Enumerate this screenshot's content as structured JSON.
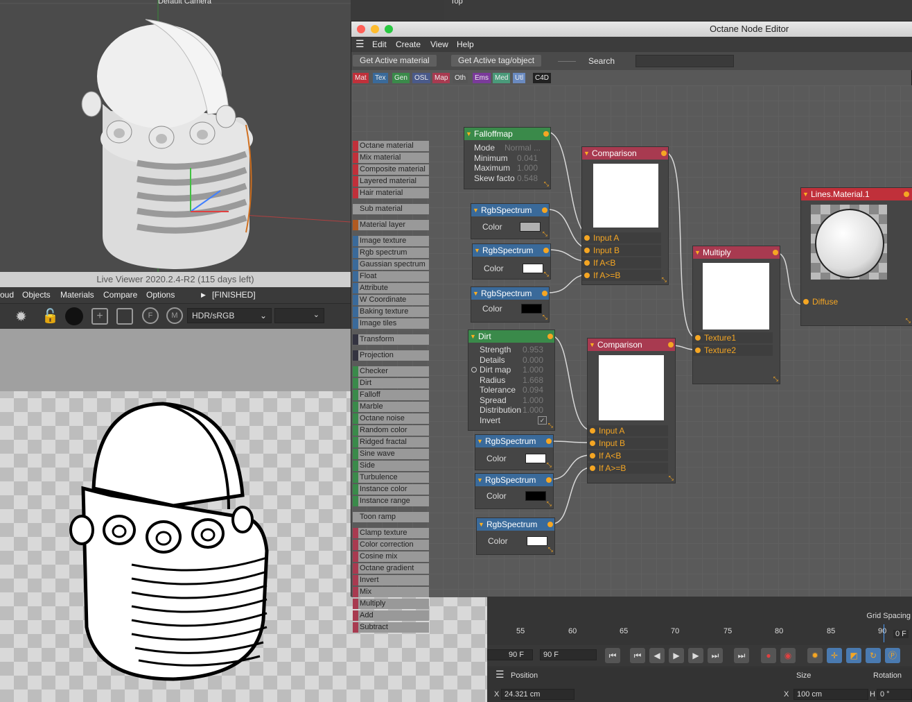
{
  "viewport": {
    "camera_label": "Default Camera",
    "top_label": "Top"
  },
  "live_viewer": {
    "title": "Live Viewer 2020.2.4-R2 (115 days left)",
    "menu": [
      "oud",
      "Objects",
      "Materials",
      "Compare",
      "Options"
    ],
    "status": "[FINISHED]",
    "color_mode": "HDR/sRGB"
  },
  "node_editor": {
    "title": "Octane Node Editor",
    "menu": [
      "Edit",
      "Create",
      "View",
      "Help"
    ],
    "buttons": {
      "get_material": "Get Active material",
      "get_tag": "Get Active tag/object",
      "search_label": "Search"
    },
    "categories": [
      {
        "label": "Mat",
        "color": "#c0303a"
      },
      {
        "label": "Tex",
        "color": "#3a6a9a"
      },
      {
        "label": "Gen",
        "color": "#3a8a4a"
      },
      {
        "label": "OSL",
        "color": "#4a5a8a"
      },
      {
        "label": "Map",
        "color": "#a83a50"
      },
      {
        "label": "Oth",
        "color": "#555555"
      },
      {
        "label": "Ems",
        "color": "#7a3a9a"
      },
      {
        "label": "Med",
        "color": "#4a9a7a"
      },
      {
        "label": "Utl",
        "color": "#6a8ac0"
      },
      {
        "label": "C4D",
        "color": "#222222"
      }
    ],
    "node_list": [
      {
        "label": "Octane material",
        "color": "#c0303a"
      },
      {
        "label": "Mix material",
        "color": "#c0303a"
      },
      {
        "label": "Composite material",
        "color": "#c0303a"
      },
      {
        "label": "Layered material",
        "color": "#c0303a"
      },
      {
        "label": "Hair material",
        "color": "#c0303a"
      },
      {
        "label": "Sub material",
        "color": "#999999"
      },
      {
        "label": "Material layer",
        "color": "#b05a20"
      },
      {
        "label": "Image texture",
        "color": "#3a6a9a"
      },
      {
        "label": "Rgb spectrum",
        "color": "#3a6a9a"
      },
      {
        "label": "Gaussian spectrum",
        "color": "#3a6a9a"
      },
      {
        "label": "Float",
        "color": "#3a6a9a"
      },
      {
        "label": "Attribute",
        "color": "#3a6a9a"
      },
      {
        "label": "W Coordinate",
        "color": "#3a6a9a"
      },
      {
        "label": "Baking texture",
        "color": "#3a6a9a"
      },
      {
        "label": "Image tiles",
        "color": "#3a6a9a"
      },
      {
        "label": "Transform",
        "color": "#333340"
      },
      {
        "label": "Projection",
        "color": "#333340"
      },
      {
        "label": "Checker",
        "color": "#3a8a4a"
      },
      {
        "label": "Dirt",
        "color": "#3a8a4a"
      },
      {
        "label": "Falloff",
        "color": "#3a8a4a"
      },
      {
        "label": "Marble",
        "color": "#3a8a4a"
      },
      {
        "label": "Octane noise",
        "color": "#3a8a4a"
      },
      {
        "label": "Random color",
        "color": "#3a8a4a"
      },
      {
        "label": "Ridged fractal",
        "color": "#3a8a4a"
      },
      {
        "label": "Sine wave",
        "color": "#3a8a4a"
      },
      {
        "label": "Side",
        "color": "#3a8a4a"
      },
      {
        "label": "Turbulence",
        "color": "#3a8a4a"
      },
      {
        "label": "Instance color",
        "color": "#3a8a4a"
      },
      {
        "label": "Instance range",
        "color": "#3a8a4a"
      },
      {
        "label": "Toon ramp",
        "color": "#999999"
      },
      {
        "label": "Clamp texture",
        "color": "#a83a50"
      },
      {
        "label": "Color correction",
        "color": "#a83a50"
      },
      {
        "label": "Cosine mix",
        "color": "#a83a50"
      },
      {
        "label": "Octane gradient",
        "color": "#a83a50"
      },
      {
        "label": "Invert",
        "color": "#a83a50"
      },
      {
        "label": "Mix",
        "color": "#a83a50"
      },
      {
        "label": "Multiply",
        "color": "#a83a50"
      },
      {
        "label": "Add",
        "color": "#a83a50"
      },
      {
        "label": "Subtract",
        "color": "#a83a50"
      }
    ],
    "falloff": {
      "title": "Falloffmap",
      "params": [
        [
          "Mode",
          "Normal ..."
        ],
        [
          "Minimum",
          "0.041"
        ],
        [
          "Maximum",
          "1.000"
        ],
        [
          "Skew facto",
          "0.548"
        ]
      ]
    },
    "dirt": {
      "title": "Dirt",
      "params": [
        [
          "Strength",
          "0.953"
        ],
        [
          "Details",
          "0.000"
        ],
        [
          "Dirt map",
          "1.000"
        ],
        [
          "Radius",
          "1.668"
        ],
        [
          "Tolerance",
          "0.094"
        ],
        [
          "Spread",
          "1.000"
        ],
        [
          "Distribution",
          "1.000"
        ],
        [
          "Invert",
          ""
        ]
      ]
    },
    "rgb_title": "RgbSpectrum",
    "color_label": "Color",
    "comparison": {
      "title": "Comparison",
      "inputs": [
        "Input A",
        "Input B",
        "If A<B",
        "If A>=B"
      ]
    },
    "multiply": {
      "title": "Multiply",
      "inputs": [
        "Texture1",
        "Texture2"
      ]
    },
    "material": {
      "title": "Lines.Material.1",
      "input": "Diffuse"
    }
  },
  "timeline": {
    "grid_spacing": "Grid Spacing",
    "ticks": [
      "55",
      "60",
      "65",
      "70",
      "75",
      "80",
      "85",
      "90"
    ],
    "frame_end": "0 F",
    "field1": "90 F",
    "field2": "90 F",
    "attr_labels": [
      "Position",
      "Size",
      "Rotation"
    ],
    "x_label": "X",
    "x_pos": "24.321 cm",
    "x_size": "100 cm",
    "h_label": "H",
    "h_rot": "0 °"
  }
}
